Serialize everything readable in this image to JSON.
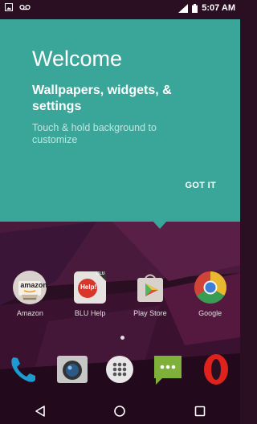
{
  "status_bar": {
    "time": "5:07 AM",
    "left_icons": [
      "gallery-icon",
      "voicemail-icon"
    ],
    "right_icons": [
      "signal-icon",
      "battery-icon"
    ]
  },
  "welcome_card": {
    "title": "Welcome",
    "heading": "Wallpapers, widgets, & settings",
    "body": "Touch & hold background to customize",
    "action_label": "GOT IT",
    "color": "#3aa69a"
  },
  "apps": [
    {
      "label": "Amazon",
      "icon": "amazon-icon",
      "badge": "amazon"
    },
    {
      "label": "BLU Help",
      "icon": "blu-help-icon",
      "badge": "Help!",
      "corner": "BLU"
    },
    {
      "label": "Play Store",
      "icon": "play-store-icon"
    },
    {
      "label": "Google",
      "icon": "chrome-icon"
    }
  ],
  "dock": [
    {
      "name": "phone-icon"
    },
    {
      "name": "camera-icon"
    },
    {
      "name": "app-drawer-icon"
    },
    {
      "name": "messaging-icon"
    },
    {
      "name": "opera-icon"
    }
  ],
  "navigation": [
    "back-icon",
    "home-icon",
    "recents-icon"
  ]
}
